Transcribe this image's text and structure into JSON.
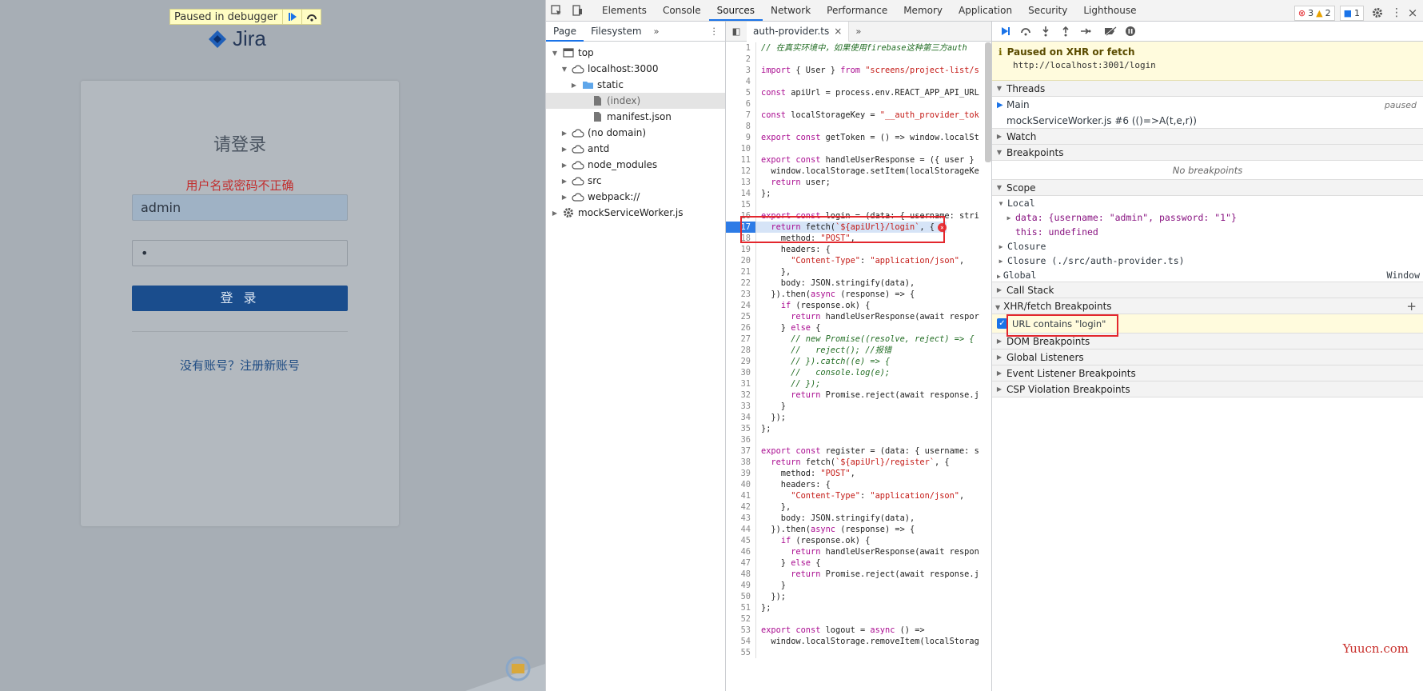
{
  "page": {
    "paused_text": "Paused in debugger",
    "logo_text": "Jira",
    "login_title": "请登录",
    "error_message": "用户名或密码不正确",
    "username_value": "admin",
    "password_mask": "•",
    "login_button": "登 录",
    "register_link": "没有账号？注册新账号"
  },
  "devtools": {
    "tabs": [
      "Elements",
      "Console",
      "Sources",
      "Network",
      "Performance",
      "Memory",
      "Application",
      "Security",
      "Lighthouse"
    ],
    "active_tab": "Sources",
    "errors": "3",
    "warnings": "2",
    "messages": "1",
    "navigator": {
      "tabs": [
        "Page",
        "Filesystem"
      ],
      "tree": [
        {
          "label": "top",
          "depth": 0,
          "arrow": "▼",
          "icon": "frame-icon"
        },
        {
          "label": "localhost:3000",
          "depth": 1,
          "arrow": "▼",
          "icon": "cloud-icon"
        },
        {
          "label": "static",
          "depth": 2,
          "arrow": "▶",
          "icon": "folder-icon"
        },
        {
          "label": "(index)",
          "depth": 3,
          "arrow": "",
          "icon": "file-icon",
          "selected": true
        },
        {
          "label": "manifest.json",
          "depth": 3,
          "arrow": "",
          "icon": "file-icon"
        },
        {
          "label": "(no domain)",
          "depth": 1,
          "arrow": "▶",
          "icon": "cloud-icon"
        },
        {
          "label": "antd",
          "depth": 1,
          "arrow": "▶",
          "icon": "cloud-icon"
        },
        {
          "label": "node_modules",
          "depth": 1,
          "arrow": "▶",
          "icon": "cloud-icon"
        },
        {
          "label": "src",
          "depth": 1,
          "arrow": "▶",
          "icon": "cloud-icon"
        },
        {
          "label": "webpack://",
          "depth": 1,
          "arrow": "▶",
          "icon": "cloud-icon"
        },
        {
          "label": "mockServiceWorker.js",
          "depth": 0,
          "arrow": "▶",
          "icon": "gear-icon"
        }
      ]
    },
    "editor": {
      "file_tab": "auth-provider.ts",
      "lines": [
        "// 在真实环境中，如果使用firebase这种第三方auth",
        "",
        "import { User } from \"screens/project-list/s",
        "",
        "const apiUrl = process.env.REACT_APP_API_URL",
        "",
        "const localStorageKey = \"__auth_provider_tok",
        "",
        "export const getToken = () => window.localSt",
        "",
        "export const handleUserResponse = ({ user }",
        "  window.localStorage.setItem(localStorageKe",
        "  return user;",
        "};",
        "",
        "export const login = (data: { username: stri",
        "  return fetch(`${apiUrl}/login`, {",
        "    method: \"POST\",",
        "    headers: {",
        "      \"Content-Type\": \"application/json\",",
        "    },",
        "    body: JSON.stringify(data),",
        "  }).then(async (response) => {",
        "    if (response.ok) {",
        "      return handleUserResponse(await respor",
        "    } else {",
        "      // new Promise((resolve, reject) => {",
        "      //   reject(); //报错",
        "      // }).catch((e) => {",
        "      //   console.log(e);",
        "      // });",
        "      return Promise.reject(await response.j",
        "    }",
        "  });",
        "};",
        "",
        "export const register = (data: { username: s",
        "  return fetch(`${apiUrl}/register`, {",
        "    method: \"POST\",",
        "    headers: {",
        "      \"Content-Type\": \"application/json\",",
        "    },",
        "    body: JSON.stringify(data),",
        "  }).then(async (response) => {",
        "    if (response.ok) {",
        "      return handleUserResponse(await respon",
        "    } else {",
        "      return Promise.reject(await response.j",
        "    }",
        "  });",
        "};",
        "",
        "export const logout = async () =>",
        "  window.localStorage.removeItem(localStorag",
        ""
      ],
      "highlight_line": 17
    },
    "debugger": {
      "pause_title": "Paused on XHR or fetch",
      "pause_url": "http://localhost:3001/login",
      "threads_label": "Threads",
      "thread_main": "Main",
      "thread_status": "paused",
      "thread_worker": "mockServiceWorker.js #6 (()=>A(t,e,r))",
      "watch_label": "Watch",
      "breakpoints_label": "Breakpoints",
      "no_breakpoints": "No breakpoints",
      "scope_label": "Scope",
      "local_label": "Local",
      "data_entry": "data: {username: \"admin\", password: \"1\"}",
      "this_entry": "this: undefined",
      "closure_label": "Closure",
      "closure_file": "Closure (./src/auth-provider.ts)",
      "global_label": "Global",
      "global_value": "Window",
      "callstack_label": "Call Stack",
      "xhr_label": "XHR/fetch Breakpoints",
      "xhr_item": "URL contains \"login\"",
      "dom_label": "DOM Breakpoints",
      "global_listeners": "Global Listeners",
      "event_listeners": "Event Listener Breakpoints",
      "csp_label": "CSP Violation Breakpoints"
    }
  },
  "watermark": "Yuucn.com",
  "colors": {
    "accent": "#1a73e8",
    "error_red": "#e3272d",
    "pause_yellow": "#fffbdd"
  }
}
